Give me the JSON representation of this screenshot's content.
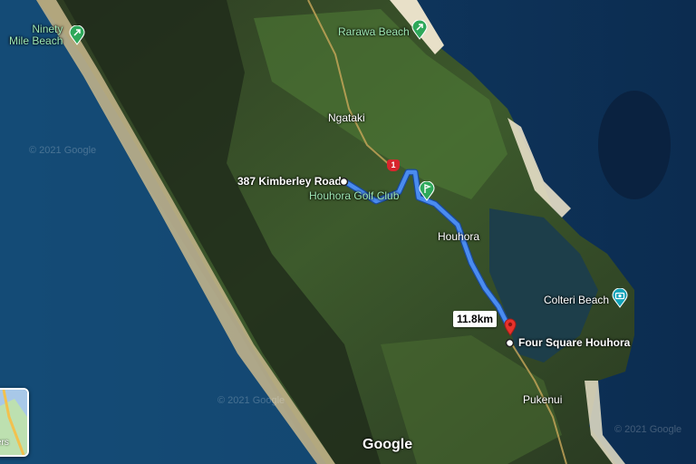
{
  "places": {
    "ninety_mile_beach": "Ninety\nMile Beach",
    "rarawa_beach": "Rarawa Beach",
    "ngataki": "Ngataki",
    "kimberley_road": "387 Kimberley Road",
    "houhora_golf_club": "Houhora Golf Club",
    "houhora": "Houhora",
    "colteri_beach": "Colteri Beach",
    "four_square_houhora": "Four Square Houhora",
    "pukenui": "Pukenui"
  },
  "route": {
    "distance": "11.8km",
    "highway_number": "1",
    "color": "#4a8cf0"
  },
  "watermarks": [
    "© 2021 Google",
    "© 2021 Google",
    "© 2021 Google"
  ],
  "google_logo": "Google",
  "layers_button": {
    "label": "ers"
  },
  "icons": {
    "beach": "beach-pin-icon",
    "golf": "golf-pin-icon",
    "camera": "camera-pin-icon",
    "destination": "red-destination-pin-icon",
    "origin": "origin-dot-icon"
  }
}
